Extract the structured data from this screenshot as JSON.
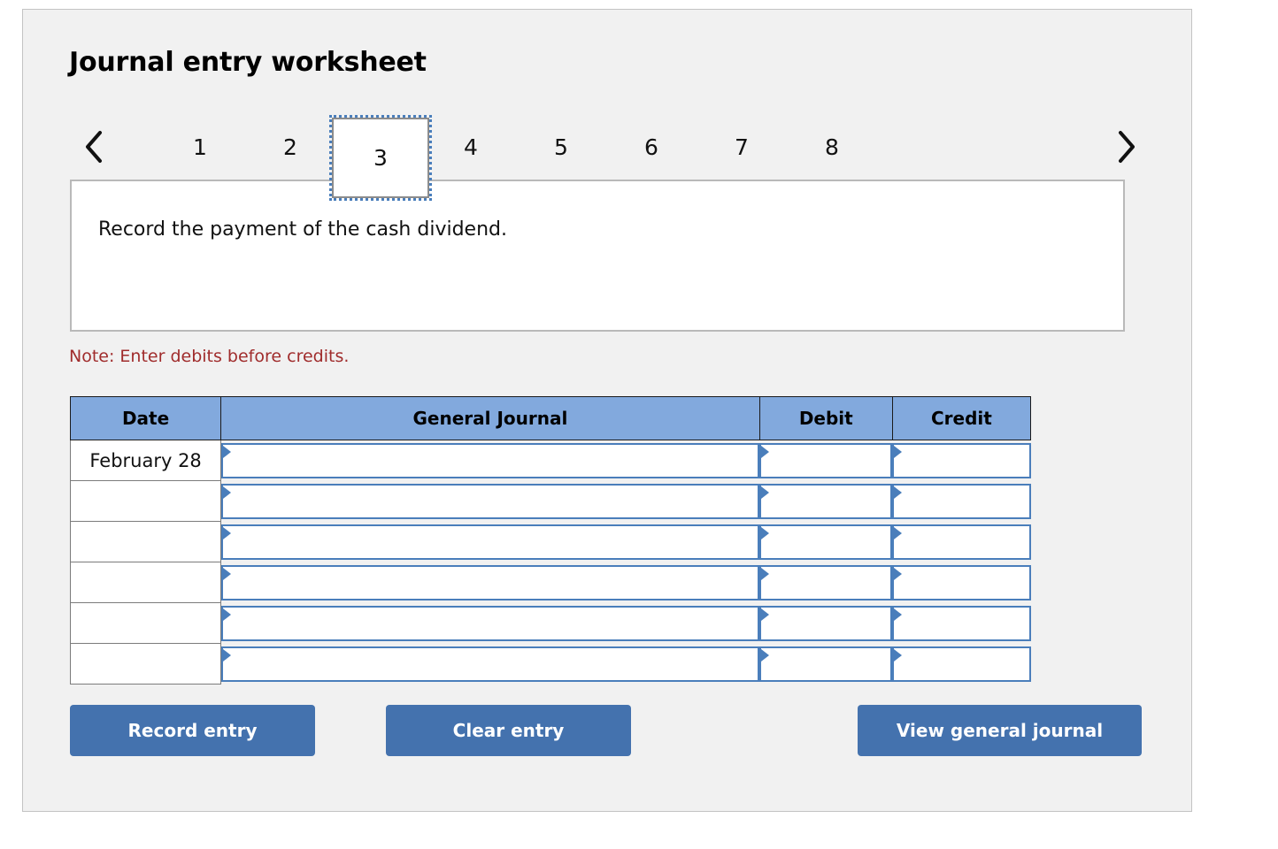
{
  "page": {
    "title": "Journal entry worksheet",
    "note": "Note: Enter debits before credits.",
    "colors": {
      "panel_bg": "#f1f1f1",
      "header_blue": "#82a9dd",
      "button_blue": "#4472ae",
      "note_red": "#a02c2c",
      "cell_border_blue": "#4a7ebb"
    }
  },
  "tabs": {
    "prev_icon": "chevron-left-icon",
    "next_icon": "chevron-right-icon",
    "active": "3",
    "items": [
      {
        "label": "1",
        "active": false
      },
      {
        "label": "2",
        "active": false
      },
      {
        "label": "3",
        "active": true
      },
      {
        "label": "4",
        "active": false
      },
      {
        "label": "5",
        "active": false
      },
      {
        "label": "6",
        "active": false
      },
      {
        "label": "7",
        "active": false
      },
      {
        "label": "8",
        "active": false
      }
    ]
  },
  "instruction": {
    "text": "Record the payment of the cash dividend."
  },
  "table": {
    "headers": [
      "Date",
      "General Journal",
      "Debit",
      "Credit"
    ],
    "rows": [
      {
        "date": "February 28",
        "account": "",
        "debit": "",
        "credit": ""
      },
      {
        "date": "",
        "account": "",
        "debit": "",
        "credit": ""
      },
      {
        "date": "",
        "account": "",
        "debit": "",
        "credit": ""
      },
      {
        "date": "",
        "account": "",
        "debit": "",
        "credit": ""
      },
      {
        "date": "",
        "account": "",
        "debit": "",
        "credit": ""
      },
      {
        "date": "",
        "account": "",
        "debit": "",
        "credit": ""
      }
    ]
  },
  "buttons": {
    "record": "Record entry",
    "clear": "Clear entry",
    "view": "View general journal"
  }
}
